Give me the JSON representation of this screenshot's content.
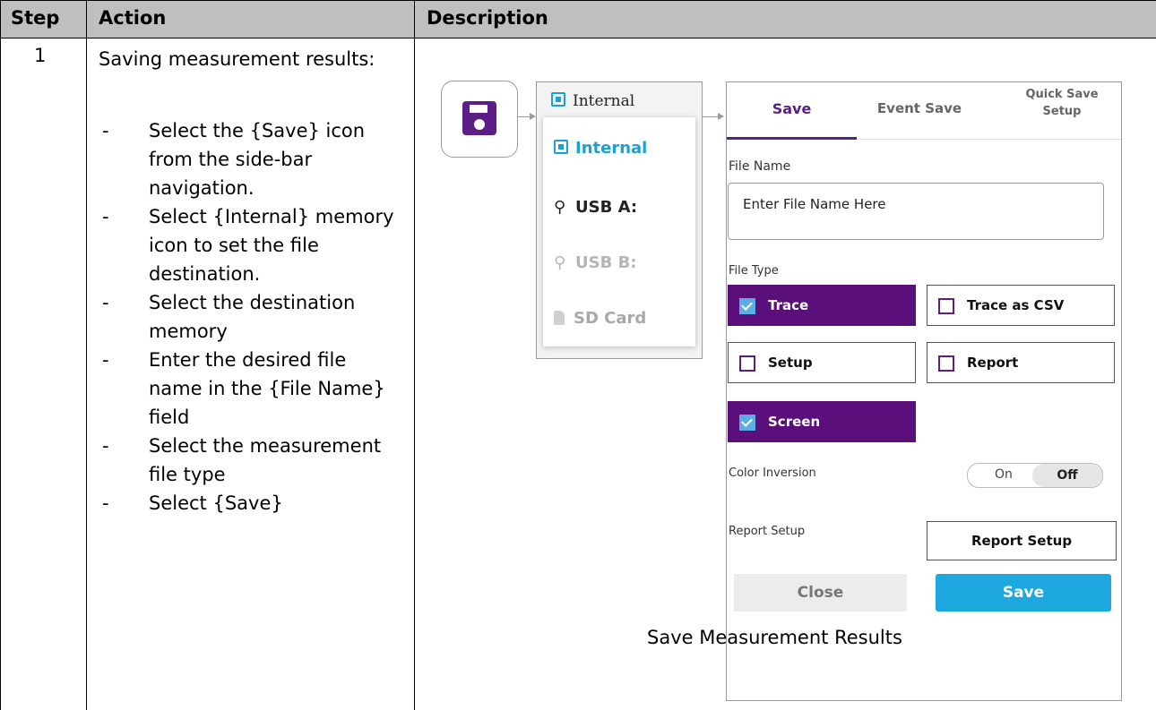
{
  "table": {
    "headers": {
      "step": "Step",
      "action": "Action",
      "description": "Description"
    },
    "step_number": "1",
    "action_title": "Saving measurement results:",
    "action_items": [
      "Select the {Save} icon from the side-bar navigation.",
      "Select {Internal} memory icon to set the file destination.",
      "Select the destination memory",
      "Enter the desired file name in the {File Name} field",
      "Select the measurement file type",
      "Select {Save}"
    ],
    "bullet": "-"
  },
  "figure": {
    "memory_current": "Internal",
    "memory_options": [
      "Internal",
      "USB A:",
      "USB B:",
      "SD Card"
    ],
    "tabs": [
      "Save",
      "Event Save",
      "Quick Save Setup"
    ],
    "file_name_label": "File Name",
    "file_name_value": "Enter File Name Here",
    "file_type_label": "File Type",
    "file_types": [
      {
        "label": "Trace",
        "checked": true
      },
      {
        "label": "Trace as CSV",
        "checked": false
      },
      {
        "label": "Setup",
        "checked": false
      },
      {
        "label": "Report",
        "checked": false
      },
      {
        "label": "Screen",
        "checked": true
      }
    ],
    "color_inversion_label": "Color Inversion",
    "toggle_on": "On",
    "toggle_off": "Off",
    "report_setup_label": "Report Setup",
    "report_setup_button": "Report Setup",
    "close_button": "Close",
    "save_button": "Save",
    "caption": "Save Measurement Results",
    "colors": {
      "accent": "#5b0f7a",
      "primary": "#1ea8e0",
      "selected_memory": "#1aa0d8"
    }
  }
}
